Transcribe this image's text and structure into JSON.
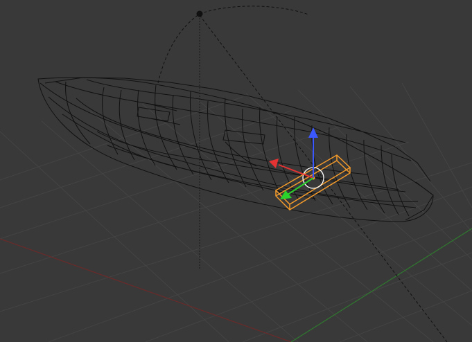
{
  "viewport": {
    "background": "#393939",
    "grid_color": "#444444",
    "x_axis_color": "#6b2a2a",
    "y_axis_color": "#2f7a2f",
    "wire_color": "#111111",
    "selection_color": "#f39a2a",
    "gizmo_x_color": "#e53232",
    "gizmo_y_color": "#2bd22b",
    "gizmo_z_color": "#3b58ff"
  },
  "scene": {
    "objects": [
      {
        "name": "hull",
        "type": "mesh",
        "display": "wireframe",
        "selected": false,
        "icon": "mesh-wireframe"
      },
      {
        "name": "selected-block",
        "type": "mesh",
        "display": "wireframe",
        "selected": true,
        "icon": "mesh-wireframe"
      },
      {
        "name": "lamp",
        "type": "light",
        "icon": "lamp-icon"
      }
    ]
  }
}
